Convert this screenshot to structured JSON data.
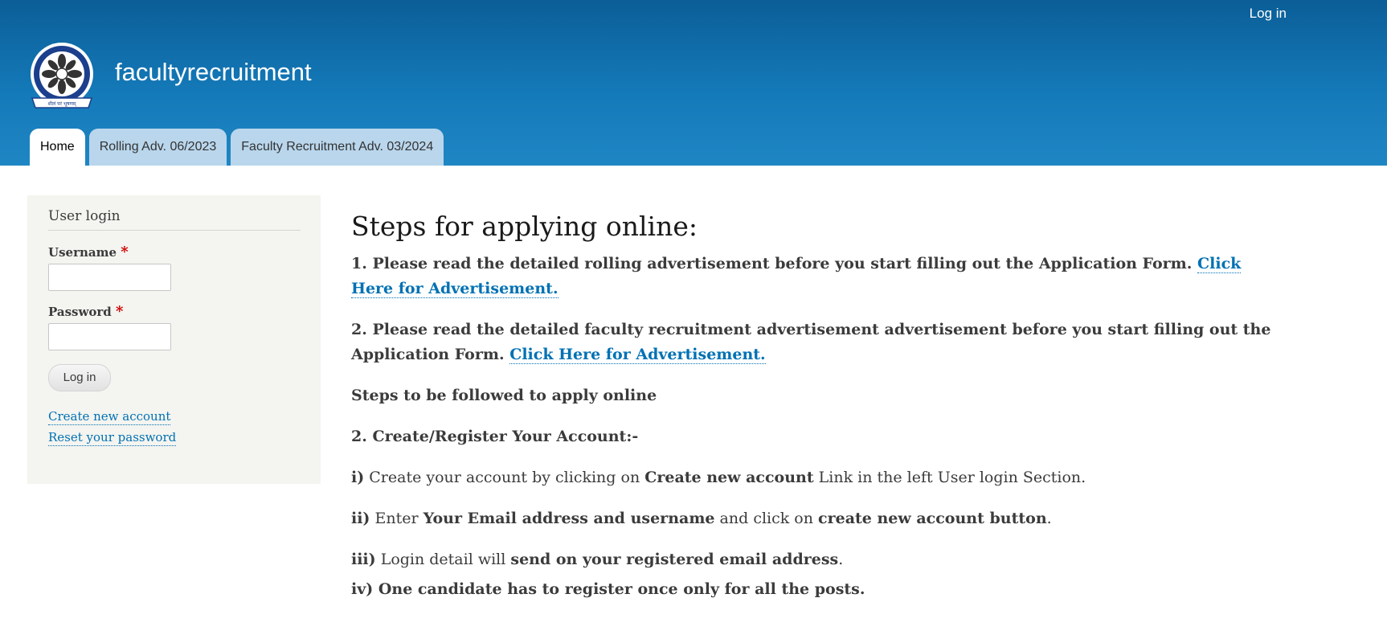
{
  "header": {
    "login_link": "Log in",
    "site_name": "facultyrecruitment",
    "logo_text": "शीलं परं भूषणम्"
  },
  "tabs": [
    {
      "label": "Home",
      "active": true
    },
    {
      "label": "Rolling Adv. 06/2023",
      "active": false
    },
    {
      "label": "Faculty Recruitment Adv. 03/2024",
      "active": false
    }
  ],
  "sidebar": {
    "title": "User login",
    "username_label": "Username",
    "password_label": "Password",
    "required_mark": "*",
    "login_button": "Log in",
    "create_account": "Create new account",
    "reset_password": "Reset your password"
  },
  "content": {
    "title": "Steps for applying online:",
    "p1_text": "1. Please read the detailed rolling advertisement before you start filling out the Application Form. ",
    "p1_link": "Click Here for Advertisement.",
    "p2_text": "2. Please read the detailed faculty recruitment advertisement advertisement before you start filling out the Application Form. ",
    "p2_link": "Click Here for Advertisement.",
    "p3": "Steps to be followed to apply online",
    "p4": "2. Create/Register Your Account:-",
    "s1_num": "i)",
    "s1_a": " Create your account by clicking on ",
    "s1_b": "Create new account",
    "s1_c": " Link in the left User login Section.",
    "s2_num": "ii)",
    "s2_a": " Enter ",
    "s2_b": "Your Email address and username",
    "s2_c": " and click on ",
    "s2_d": "create new account button",
    "s2_e": ".",
    "s3_num": "iii)",
    "s3_a": " Login detail will ",
    "s3_b": "send on your registered email address",
    "s3_c": ".",
    "s4": "iv) One candidate has to register once only for all the posts."
  },
  "colors": {
    "header_top": "#0b5e97",
    "header_bottom": "#1f86c4",
    "link": "#0071b3",
    "required": "#cc0000"
  }
}
